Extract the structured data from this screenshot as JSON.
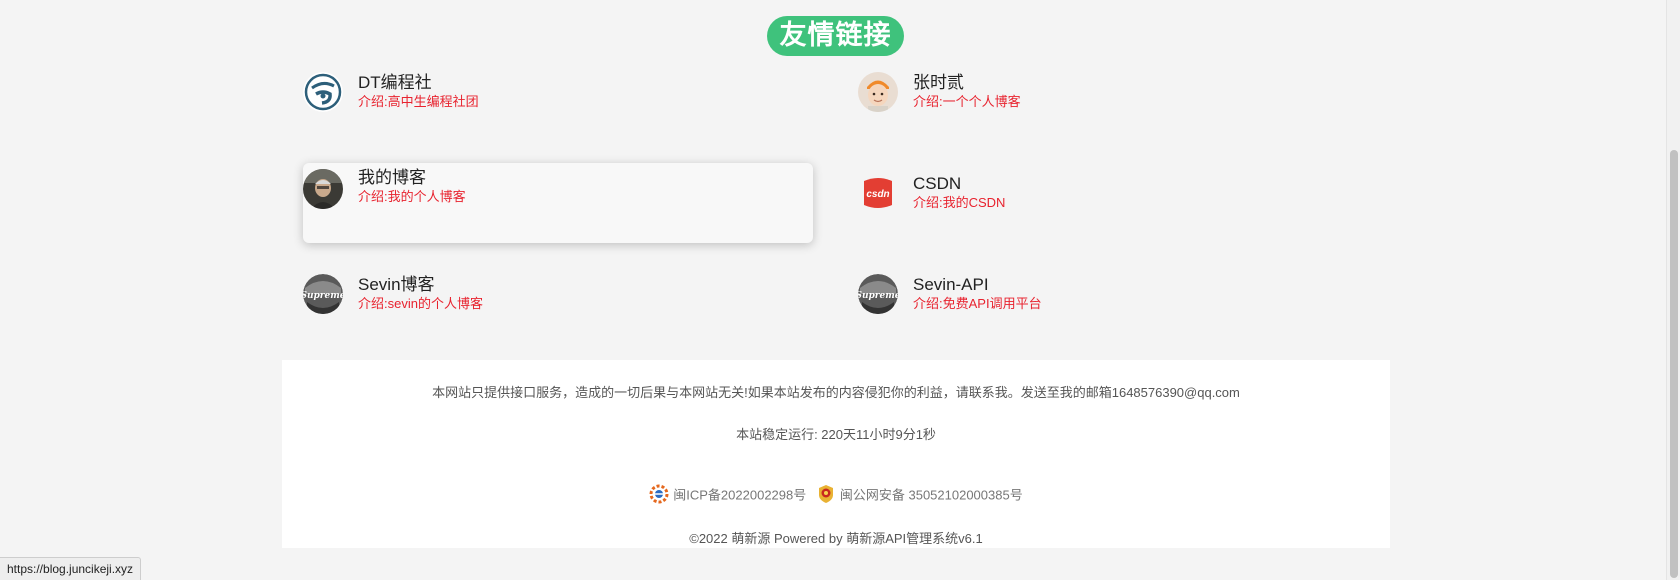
{
  "section_title": "友情链接",
  "links": [
    {
      "name": "DT编程社",
      "desc": "介绍:高中生编程社团",
      "icon": "dt-logo-icon"
    },
    {
      "name": "张时贰",
      "desc": "介绍:一个个人博客",
      "icon": "child-avatar-icon"
    },
    {
      "name": "我的博客",
      "desc": "介绍:我的个人博客",
      "icon": "portrait-avatar-icon"
    },
    {
      "name": "CSDN",
      "desc": "介绍:我的CSDN",
      "icon": "csdn-logo-icon"
    },
    {
      "name": "Sevin博客",
      "desc": "介绍:sevin的个人博客",
      "icon": "supreme-avatar-icon"
    },
    {
      "name": "Sevin-API",
      "desc": "介绍:免费API调用平台",
      "icon": "supreme-avatar-icon"
    }
  ],
  "footer": {
    "disclaimer": "本网站只提供接口服务，造成的一切后果与本网站无关!如果本站发布的内容侵犯你的利益，请联系我。发送至我的邮箱1648576390@qq.com",
    "uptime": "本站稳定运行: 220天11小时9分1秒",
    "icp": "闽ICP备2022002298号",
    "police": "闽公网安备 35052102000385号",
    "copyright": "©2022 萌新源 Powered by 萌新源API管理系统v6.1"
  },
  "status_bar_url": "https://blog.juncikeji.xyz",
  "colors": {
    "accent_green": "#3fc27c",
    "desc_red": "#e8232f",
    "csdn_red": "#e33e33"
  }
}
